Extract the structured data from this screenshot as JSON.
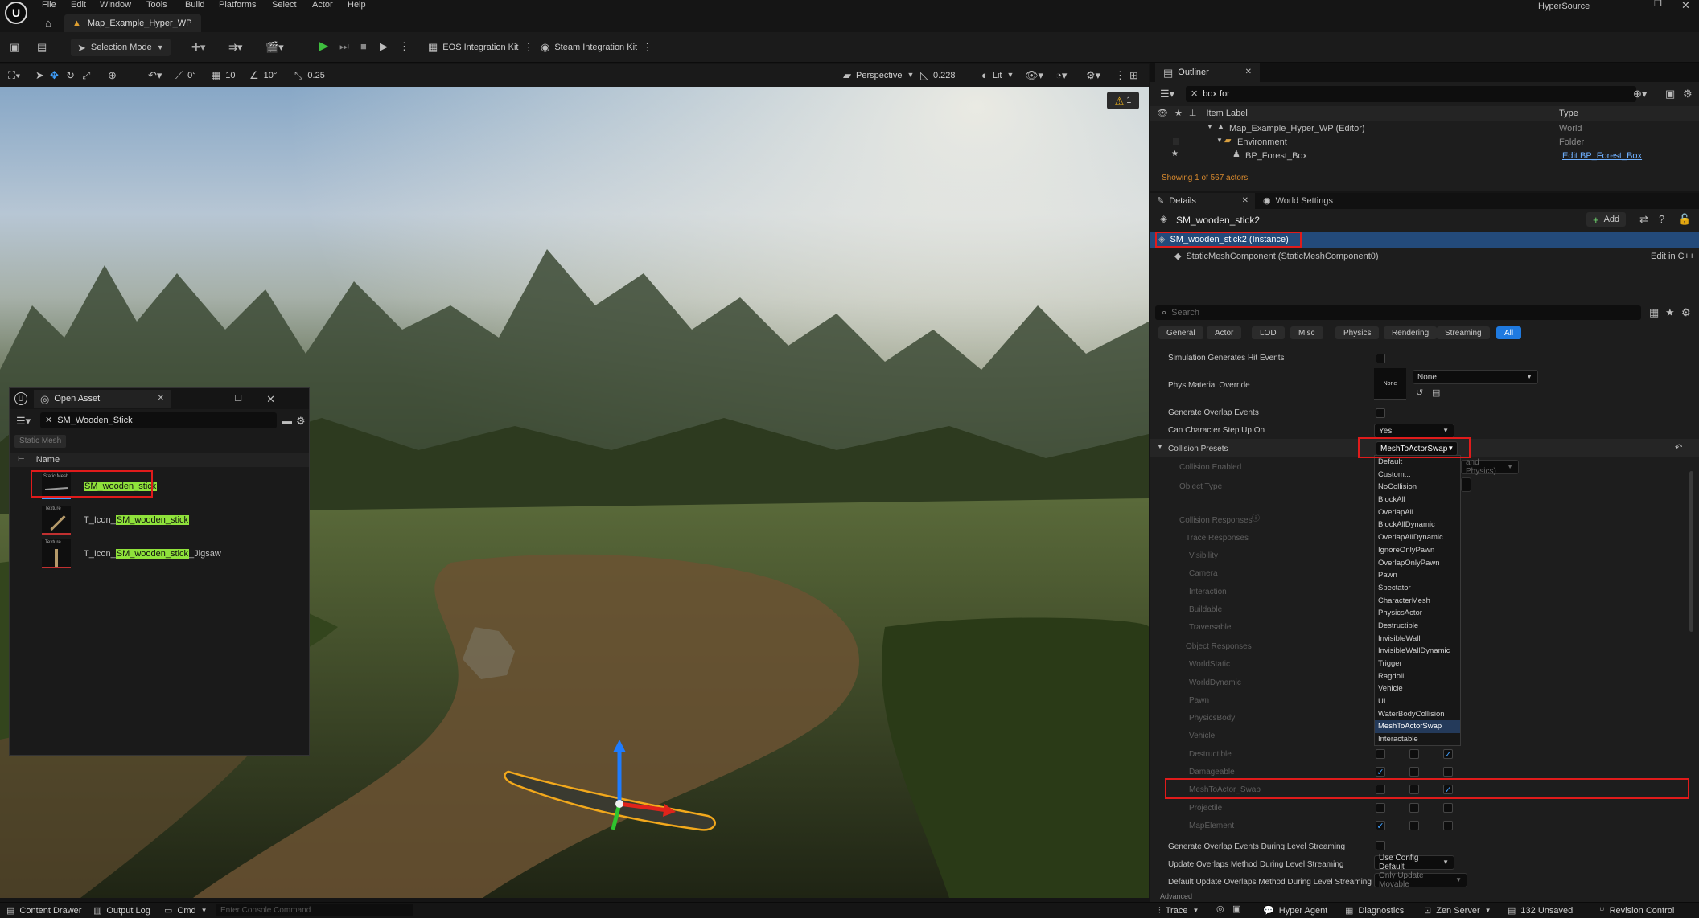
{
  "app": {
    "title": "HyperSource",
    "tab": "Map_Example_Hyper_WP"
  },
  "menu": [
    "File",
    "Edit",
    "Window",
    "Tools",
    "Build",
    "Platforms",
    "Select",
    "Actor",
    "Help"
  ],
  "toolbar": {
    "mode": "Selection Mode",
    "eos": "EOS Integration Kit",
    "steam": "Steam Integration Kit"
  },
  "viewport_bar": {
    "angle": "0°",
    "grid": "10",
    "rotate": "10°",
    "scale": "0.25",
    "view": "Perspective",
    "fov": "0.228",
    "lit": "Lit",
    "warn": "1"
  },
  "outliner": {
    "title": "Outliner",
    "search": "box for",
    "col_label": "Item Label",
    "col_type": "Type",
    "items": [
      {
        "label": "Map_Example_Hyper_WP (Editor)",
        "type": "World"
      },
      {
        "label": "Environment",
        "type": "Folder"
      },
      {
        "label": "BP_Forest_Box",
        "type": "Edit BP_Forest_Box"
      }
    ],
    "footer": "Showing 1 of 567 actors"
  },
  "details": {
    "tab": "Details",
    "tab2": "World Settings",
    "title": "SM_wooden_stick2",
    "add": "Add",
    "instance": "SM_wooden_stick2 (Instance)",
    "component": "StaticMeshComponent (StaticMeshComponent0)",
    "edit_cpp": "Edit in C++",
    "search_placeholder": "Search",
    "categories": [
      "General",
      "Actor",
      "LOD",
      "Misc",
      "Physics",
      "Rendering",
      "Streaming",
      "All"
    ]
  },
  "props": {
    "sim_hit": "Simulation Generates Hit Events",
    "phys_mat": "Phys Material Override",
    "phys_mat_value": "None",
    "phys_thumb": "None",
    "gen_overlap": "Generate Overlap Events",
    "step_up": "Can Character Step Up On",
    "step_up_value": "Yes",
    "presets": "Collision Presets",
    "presets_value": "MeshToActorSwap",
    "coll_enabled": "Collision Enabled",
    "coll_enabled_value": "and Physics)",
    "obj_type": "Object Type",
    "coll_resp": "Collision Responses",
    "trace_resp": "Trace Responses",
    "obj_resp": "Object Responses",
    "trace_items": [
      "Visibility",
      "Camera",
      "Interaction",
      "Buildable",
      "Traversable"
    ],
    "obj_items": [
      "WorldStatic",
      "WorldDynamic",
      "Pawn",
      "PhysicsBody",
      "Vehicle",
      "Destructible",
      "Damageable",
      "MeshToActor_Swap",
      "Projectile",
      "MapElement"
    ],
    "gen_overlap_stream": "Generate Overlap Events During Level Streaming",
    "update_overlap": "Update Overlaps Method During Level Streaming",
    "update_overlap_value": "Use Config Default",
    "default_update": "Default Update Overlaps Method During Level Streaming",
    "default_update_value": "Only Update Movable",
    "advanced": "Advanced"
  },
  "preset_options": [
    "Default",
    "Custom...",
    "NoCollision",
    "BlockAll",
    "OverlapAll",
    "BlockAllDynamic",
    "OverlapAllDynamic",
    "IgnoreOnlyPawn",
    "OverlapOnlyPawn",
    "Pawn",
    "Spectator",
    "CharacterMesh",
    "PhysicsActor",
    "Destructible",
    "InvisibleWall",
    "InvisibleWallDynamic",
    "Trigger",
    "Ragdoll",
    "Vehicle",
    "UI",
    "WaterBodyCollision",
    "MeshToActorSwap",
    "Interactable"
  ],
  "open_asset": {
    "title": "Open Asset",
    "search": "SM_Wooden_Stick",
    "filter": "Static Mesh",
    "col": "Name",
    "items": [
      {
        "badge": "Static Mesh",
        "pre": "",
        "hl": "SM_wooden_stick",
        "post": ""
      },
      {
        "badge": "Texture",
        "pre": "T_Icon_",
        "hl": "SM_wooden_stick",
        "post": ""
      },
      {
        "badge": "Texture",
        "pre": "T_Icon_",
        "hl": "SM_wooden_stick",
        "post": "_Jigsaw"
      }
    ]
  },
  "status": {
    "content": "Content Drawer",
    "output": "Output Log",
    "cmd": "Cmd",
    "console_placeholder": "Enter Console Command",
    "trace": "Trace",
    "hyper": "Hyper Agent",
    "diag": "Diagnostics",
    "zen": "Zen Server",
    "unsaved": "132 Unsaved",
    "revision": "Revision Control"
  }
}
